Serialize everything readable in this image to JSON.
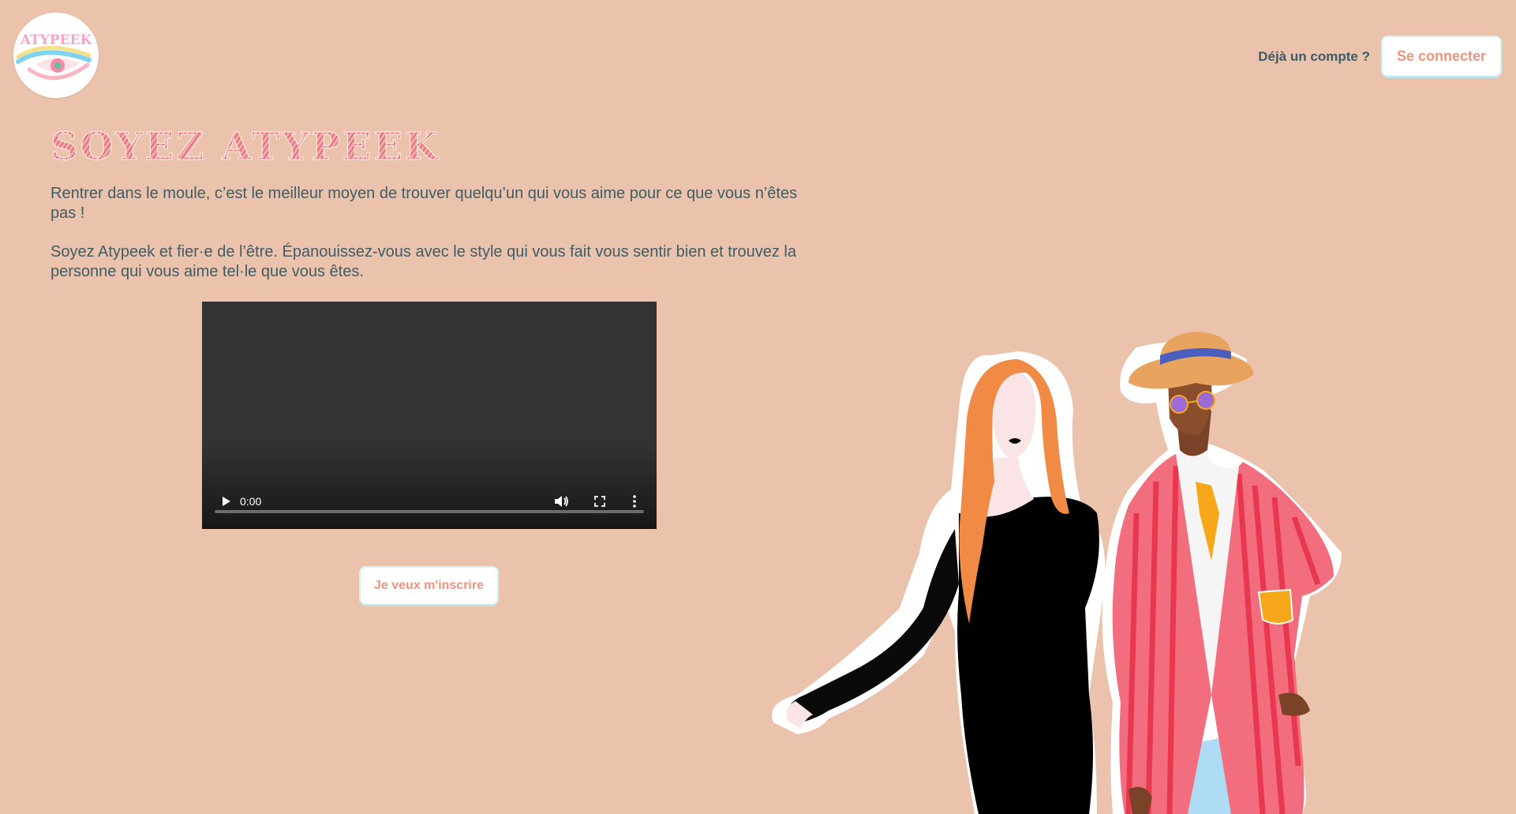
{
  "brand": {
    "logo_text": "ATYPEEK"
  },
  "header": {
    "account_prompt": "Déjà un compte ?",
    "login_label": "Se connecter"
  },
  "hero": {
    "title": "SOYEZ ATYPEEK",
    "paragraph_1": "Rentrer dans le moule, c’est le meilleur moyen de trouver quelqu’un qui vous aime pour ce que vous n’êtes pas !",
    "paragraph_2": "Soyez Atypeek et fier·e de l’être. Épanouissez-vous avec le style qui vous fait vous sentir bien et trouvez la personne qui vous aime tel·le que vous êtes.",
    "signup_label": "Je veux m'inscrire"
  },
  "video": {
    "current_time": "0:00",
    "progress": 0
  },
  "colors": {
    "background": "#ebc2ab",
    "text": "#3f5d66",
    "accent": "#f0937d",
    "title_red": "#d94a55"
  }
}
